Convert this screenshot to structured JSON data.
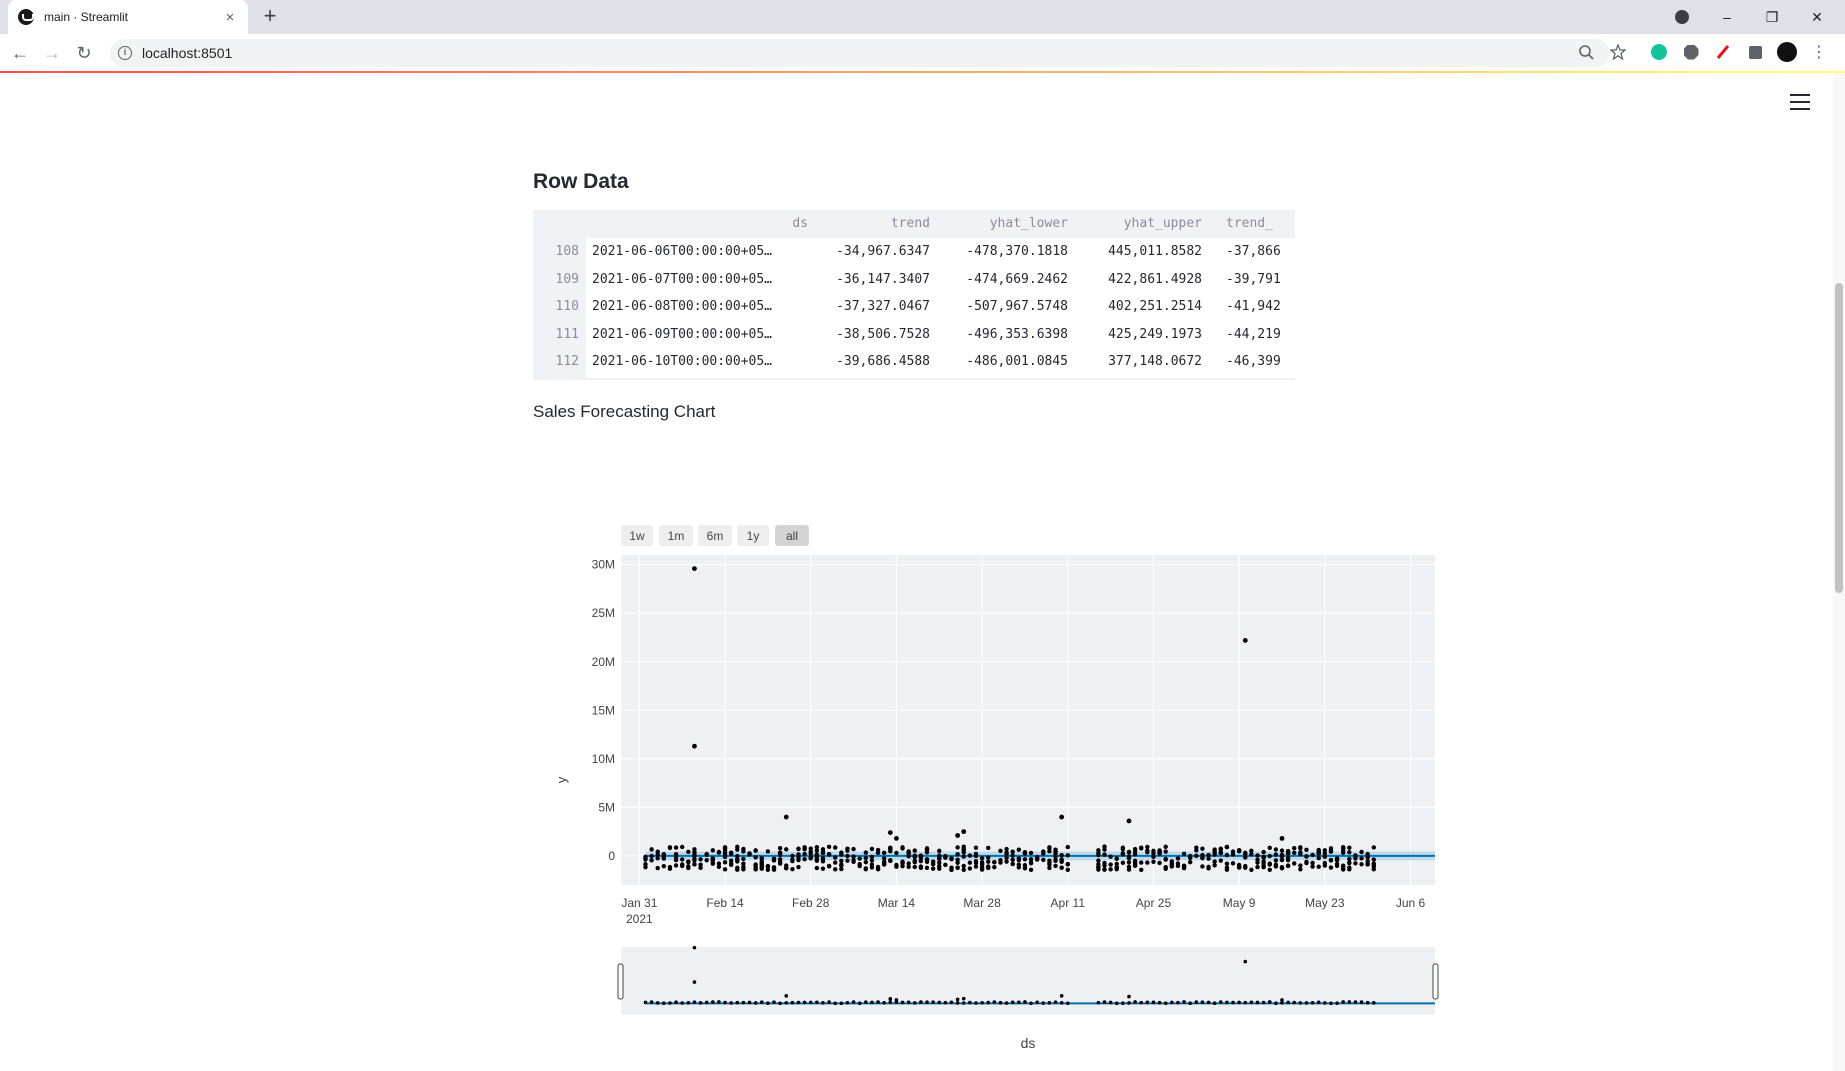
{
  "browser": {
    "tab_title": "main · Streamlit",
    "tab_close": "×",
    "new_tab": "+",
    "url": "localhost:8501",
    "win_minimize": "–",
    "win_restore": "❐",
    "win_close": "✕",
    "nav_back": "←",
    "nav_forward": "→",
    "nav_reload": "↻",
    "info": "i",
    "kebab": "⋮"
  },
  "page": {
    "heading": "Row Data",
    "chart_heading": "Sales Forecasting Chart",
    "theme": {
      "text": "#262730",
      "accent": "#ff4b4b",
      "df_bg": "#f0f2f6"
    }
  },
  "dataframe": {
    "columns": [
      "ds",
      "trend",
      "yhat_lower",
      "yhat_upper",
      "trend_"
    ],
    "rows": [
      {
        "index": "108",
        "cells": [
          "2021-06-06T00:00:00+05…",
          "-34,967.6347",
          "-478,370.1818",
          "445,011.8582",
          "-37,866"
        ]
      },
      {
        "index": "109",
        "cells": [
          "2021-06-07T00:00:00+05…",
          "-36,147.3407",
          "-474,669.2462",
          "422,861.4928",
          "-39,791"
        ]
      },
      {
        "index": "110",
        "cells": [
          "2021-06-08T00:00:00+05…",
          "-37,327.0467",
          "-507,967.5748",
          "402,251.2514",
          "-41,942"
        ]
      },
      {
        "index": "111",
        "cells": [
          "2021-06-09T00:00:00+05…",
          "-38,506.7528",
          "-496,353.6398",
          "425,249.1973",
          "-44,219"
        ]
      },
      {
        "index": "112",
        "cells": [
          "2021-06-10T00:00:00+05…",
          "-39,686.4588",
          "-486,001.0845",
          "377,148.0672",
          "-46,399"
        ]
      }
    ]
  },
  "range_selector": {
    "buttons": [
      "1w",
      "1m",
      "6m",
      "1y",
      "all"
    ],
    "active": "all"
  },
  "chart_data": {
    "type": "scatter",
    "xlabel": "ds",
    "ylabel": "y",
    "x_start_label": "Jan 31\n2021",
    "x_ticks": [
      "Jan 31",
      "Feb 14",
      "Feb 28",
      "Mar 14",
      "Mar 28",
      "Apr 11",
      "Apr 25",
      "May 9",
      "May 23",
      "Jun 6"
    ],
    "x_tick_year": "2021",
    "x_range": [
      "2021-01-28",
      "2021-06-10"
    ],
    "y_ticks": [
      "0",
      "5M",
      "10M",
      "15M",
      "20M",
      "25M",
      "30M"
    ],
    "y_tick_values": [
      0,
      5000000,
      10000000,
      15000000,
      20000000,
      25000000,
      30000000
    ],
    "y_range": [
      -3000000,
      31000000
    ],
    "grid": true,
    "colors": {
      "points": "#000000",
      "forecast": "#0072b2",
      "band": "#9ecae1",
      "plot_bg": "#eef0f4"
    },
    "outliers": [
      {
        "x": "2021-02-09",
        "y": 29600000
      },
      {
        "x": "2021-02-09",
        "y": 11300000
      },
      {
        "x": "2021-02-24",
        "y": 4000000
      },
      {
        "x": "2021-03-13",
        "y": 2400000
      },
      {
        "x": "2021-03-14",
        "y": 1800000
      },
      {
        "x": "2021-03-24",
        "y": 2100000
      },
      {
        "x": "2021-03-25",
        "y": 2500000
      },
      {
        "x": "2021-04-10",
        "y": 4000000
      },
      {
        "x": "2021-04-21",
        "y": 3600000
      },
      {
        "x": "2021-05-10",
        "y": 22200000
      },
      {
        "x": "2021-05-16",
        "y": 1800000
      }
    ],
    "active_days": {
      "from": "2021-02-01",
      "to": "2021-05-31",
      "gaps": [
        [
          "2021-04-12",
          "2021-04-15"
        ]
      ]
    }
  }
}
